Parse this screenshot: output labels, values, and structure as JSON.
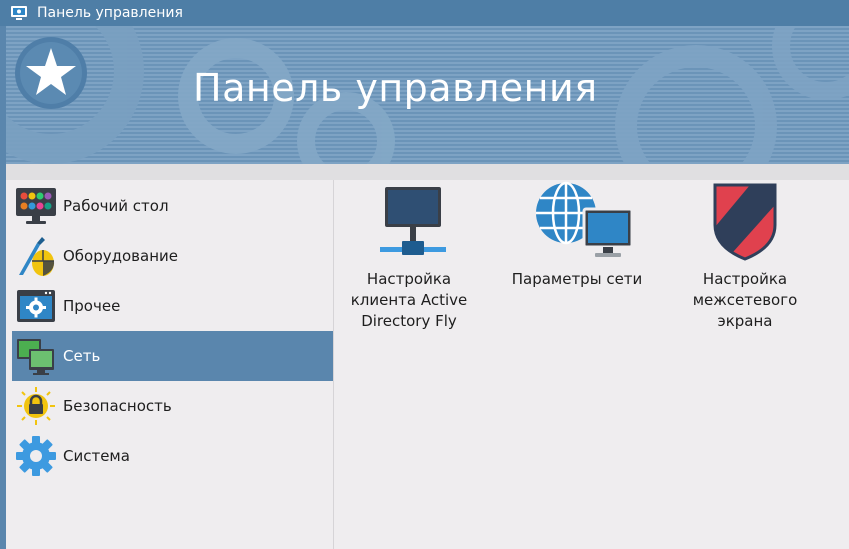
{
  "window": {
    "title": "Панель управления"
  },
  "banner": {
    "title": "Панель управления"
  },
  "sidebar": {
    "items": [
      {
        "label": "Рабочий стол",
        "icon": "desktop-icon"
      },
      {
        "label": "Оборудование",
        "icon": "hardware-icon"
      },
      {
        "label": "Прочее",
        "icon": "other-settings-icon"
      },
      {
        "label": "Сеть",
        "icon": "network-icon",
        "selected": true
      },
      {
        "label": "Безопасность",
        "icon": "security-lock-icon"
      },
      {
        "label": "Система",
        "icon": "system-gear-icon"
      }
    ]
  },
  "content": {
    "items": [
      {
        "line1": "Настройка",
        "line2": "клиента Active",
        "line3": "Directory Fly",
        "icon": "active-directory-icon"
      },
      {
        "line1": "Параметры сети",
        "icon": "network-settings-icon"
      },
      {
        "line1": "Настройка",
        "line2": "межсетевого",
        "line3": "экрана",
        "icon": "firewall-shield-icon"
      }
    ]
  },
  "colors": {
    "accent": "#5a86ad",
    "background": "#efedef"
  }
}
